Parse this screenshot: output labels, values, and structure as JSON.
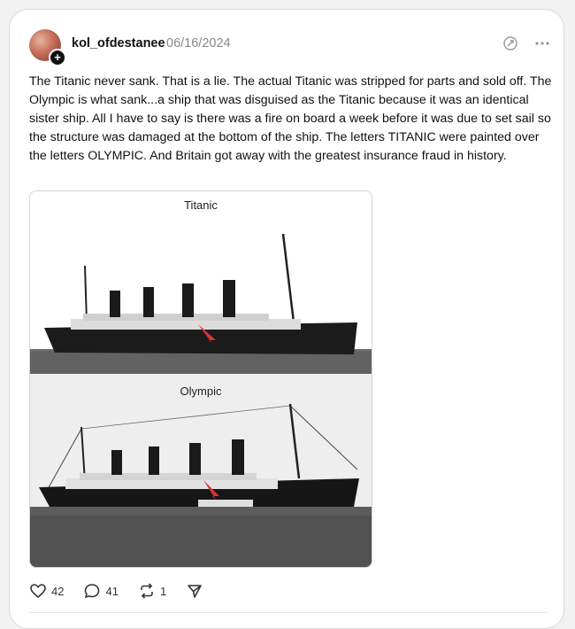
{
  "post": {
    "username": "kol_ofdestanee",
    "date": "06/16/2024",
    "text": "The Titanic never sank. That is a lie. The actual Titanic was stripped for parts and sold off. The Olympic is what sank...a ship that was disguised as the Titanic because it was an identical sister ship. All I have to say is there was a fire on board a week before it was due to set sail so the structure was damaged at the bottom of the ship. The letters TITANIC were painted over the letters OLYMPIC. And Britain got away with the greatest insurance fraud in history.",
    "image": {
      "top_caption": "Titanic",
      "bottom_caption": "Olympic"
    },
    "stats": {
      "likes": "42",
      "replies": "41",
      "reposts": "1"
    }
  },
  "icons": {
    "follow": "plus-icon",
    "translate": "translate-icon",
    "more": "more-icon",
    "like": "heart-icon",
    "reply": "comment-icon",
    "repost": "repost-icon",
    "share": "share-icon"
  }
}
